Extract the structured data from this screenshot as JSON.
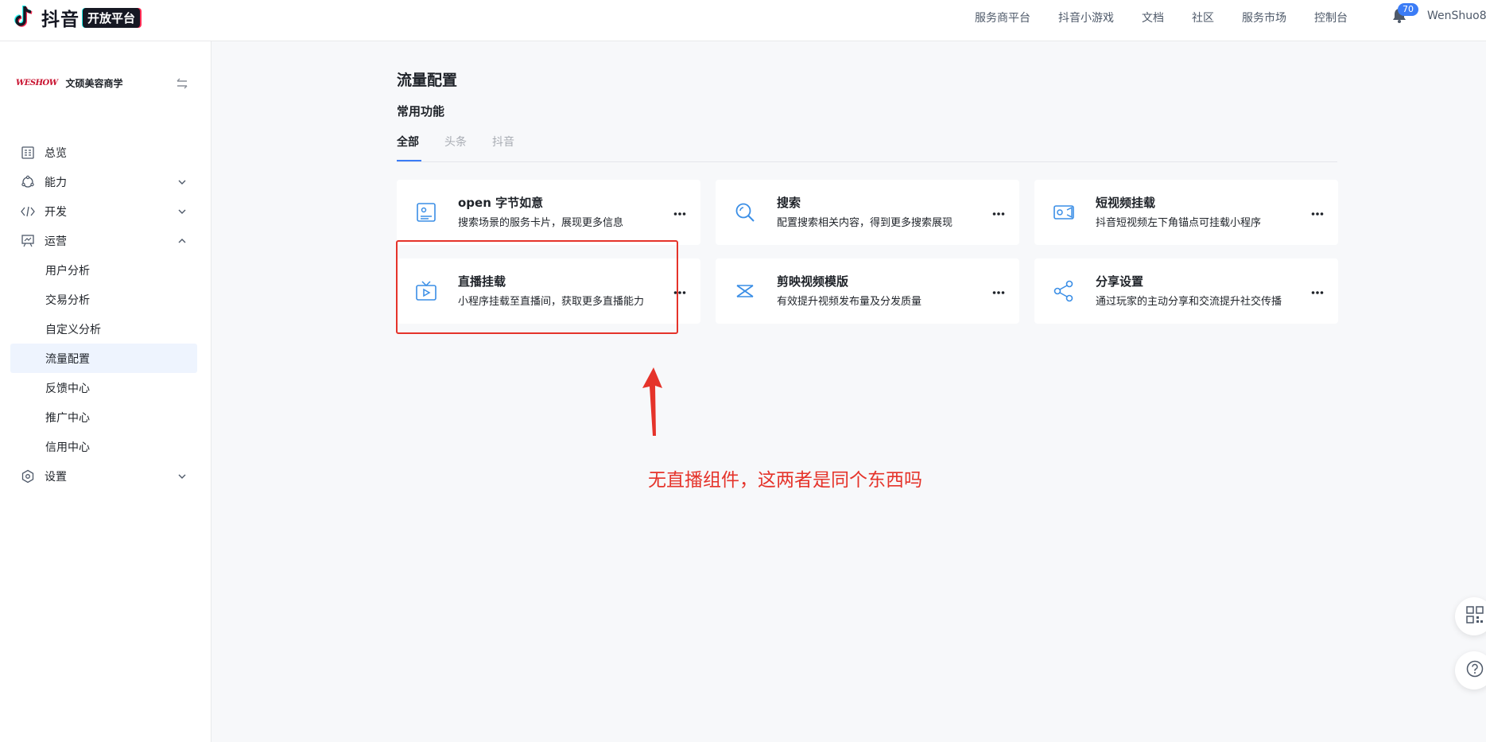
{
  "header": {
    "logo_text": "抖音",
    "logo_badge": "开放平台",
    "nav": [
      "服务商平台",
      "抖音小游戏",
      "文档",
      "社区",
      "服务市场",
      "控制台"
    ],
    "notification_count": "70",
    "username": "WenShuo8"
  },
  "sidebar": {
    "brand_logo": "WESHOW",
    "brand_name": "文硕美容商学",
    "menu": [
      {
        "label": "总览",
        "icon": "dashboard-icon",
        "expandable": false
      },
      {
        "label": "能力",
        "icon": "capability-icon",
        "expandable": true,
        "expanded": false
      },
      {
        "label": "开发",
        "icon": "code-icon",
        "expandable": true,
        "expanded": false
      },
      {
        "label": "运营",
        "icon": "chart-board-icon",
        "expandable": true,
        "expanded": true
      }
    ],
    "submenu": [
      "用户分析",
      "交易分析",
      "自定义分析",
      "流量配置",
      "反馈中心",
      "推广中心",
      "信用中心"
    ],
    "active_submenu": "流量配置",
    "settings_label": "设置"
  },
  "main": {
    "page_title": "流量配置",
    "section_title": "常用功能",
    "tabs": [
      "全部",
      "头条",
      "抖音"
    ],
    "active_tab": "全部",
    "cards": [
      {
        "title": "open 字节如意",
        "desc": "搜索场景的服务卡片，展现更多信息",
        "icon": "id-card-icon"
      },
      {
        "title": "搜索",
        "desc": "配置搜索相关内容，得到更多搜索展现",
        "icon": "search-icon"
      },
      {
        "title": "短视频挂载",
        "desc": "抖音短视频左下角锚点可挂载小程序",
        "icon": "video-camera-icon"
      },
      {
        "title": "直播挂载",
        "desc": "小程序挂载至直播间，获取更多直播能力",
        "icon": "live-tv-icon"
      },
      {
        "title": "剪映视频模版",
        "desc": "有效提升视频发布量及分发质量",
        "icon": "capcut-icon"
      },
      {
        "title": "分享设置",
        "desc": "通过玩家的主动分享和交流提升社交传播",
        "icon": "share-icon"
      }
    ]
  },
  "annotation": {
    "text": "无直播组件，这两者是同个东西吗",
    "color": "#e5332a"
  },
  "colors": {
    "accent": "#3b7cf6",
    "icon": "#3a8ee6",
    "active_bg": "#eef4fe",
    "annotation": "#e5332a"
  }
}
